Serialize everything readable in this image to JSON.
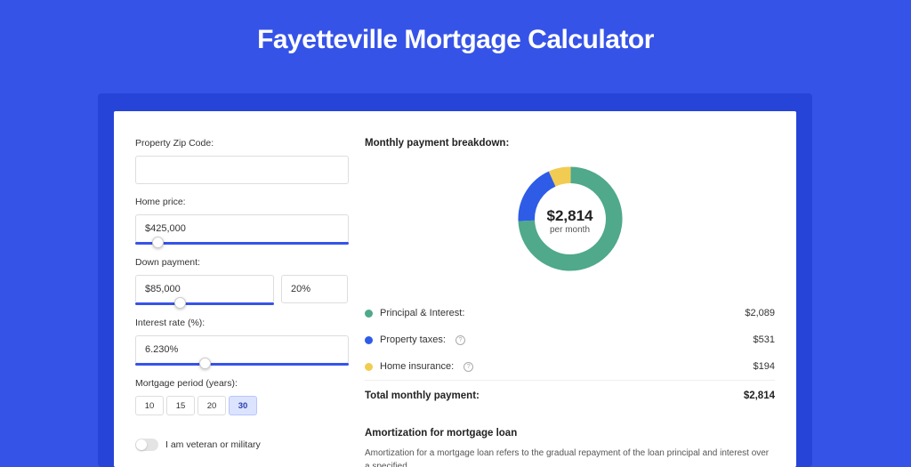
{
  "page_title": "Fayetteville Mortgage Calculator",
  "colors": {
    "blue_bg": "#3653E8",
    "green": "#4FA98A",
    "blue": "#2E5CE6",
    "yellow": "#F2CC52"
  },
  "inputs": {
    "zip_label": "Property Zip Code:",
    "zip_value": "",
    "home_price_label": "Home price:",
    "home_price_value": "$425,000",
    "down_payment_label": "Down payment:",
    "down_payment_amount": "$85,000",
    "down_payment_pct": "20%",
    "interest_label": "Interest rate (%):",
    "interest_value": "6.230%",
    "period_label": "Mortgage period (years):",
    "periods": [
      "10",
      "15",
      "20",
      "30"
    ],
    "period_active_index": 3,
    "veteran_label": "I am veteran or military",
    "sliders": {
      "home_price_pct": 8,
      "down_payment_pct": 20,
      "interest_pct": 30
    }
  },
  "breakdown": {
    "title": "Monthly payment breakdown:",
    "total_value": "$2,814",
    "total_sub": "per month",
    "items": [
      {
        "label": "Principal & Interest:",
        "value": "$2,089",
        "color": "#4FA98A",
        "info": false
      },
      {
        "label": "Property taxes:",
        "value": "$531",
        "color": "#2E5CE6",
        "info": true
      },
      {
        "label": "Home insurance:",
        "value": "$194",
        "color": "#F2CC52",
        "info": true
      }
    ],
    "total_label": "Total monthly payment:",
    "total_amount": "$2,814"
  },
  "amortization": {
    "title": "Amortization for mortgage loan",
    "text": "Amortization for a mortgage loan refers to the gradual repayment of the loan principal and interest over a specified"
  },
  "chart_data": {
    "type": "pie",
    "title": "Monthly payment breakdown",
    "series": [
      {
        "name": "Principal & Interest",
        "value": 2089,
        "color": "#4FA98A"
      },
      {
        "name": "Property taxes",
        "value": 531,
        "color": "#2E5CE6"
      },
      {
        "name": "Home insurance",
        "value": 194,
        "color": "#F2CC52"
      }
    ],
    "total": 2814,
    "unit": "USD/month"
  }
}
